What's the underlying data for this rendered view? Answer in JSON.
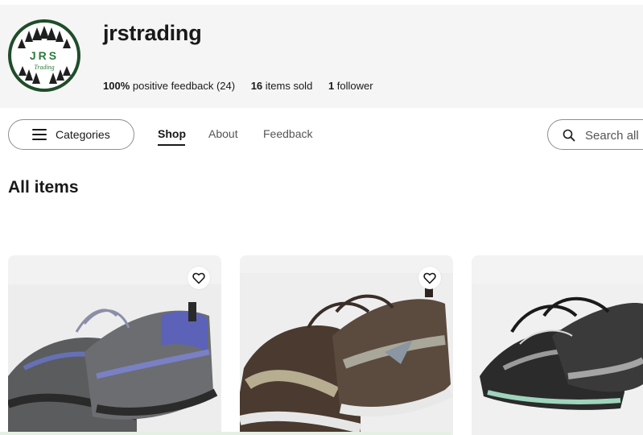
{
  "store": {
    "name": "jrstrading",
    "logo": {
      "text_main": "JRS",
      "text_sub": "Trading",
      "ring_color": "#1f4d2a"
    },
    "feedback_percent": "100%",
    "feedback_label": "positive feedback (24)",
    "items_sold_count": "16",
    "items_sold_label": "items sold",
    "followers_count": "1",
    "followers_label": "follower"
  },
  "nav": {
    "categories_label": "Categories",
    "tabs": [
      {
        "label": "Shop",
        "active": true
      },
      {
        "label": "About",
        "active": false
      },
      {
        "label": "Feedback",
        "active": false
      }
    ],
    "search_placeholder": "Search all"
  },
  "main": {
    "section_title": "All items",
    "items": [
      {
        "image": "gray-blue-sneakers",
        "watch_icon": "heart-icon"
      },
      {
        "image": "brown-silver-trail-sneakers",
        "watch_icon": "heart-icon"
      },
      {
        "image": "black-silver-running-shoes",
        "watch_icon": "heart-icon"
      }
    ]
  }
}
